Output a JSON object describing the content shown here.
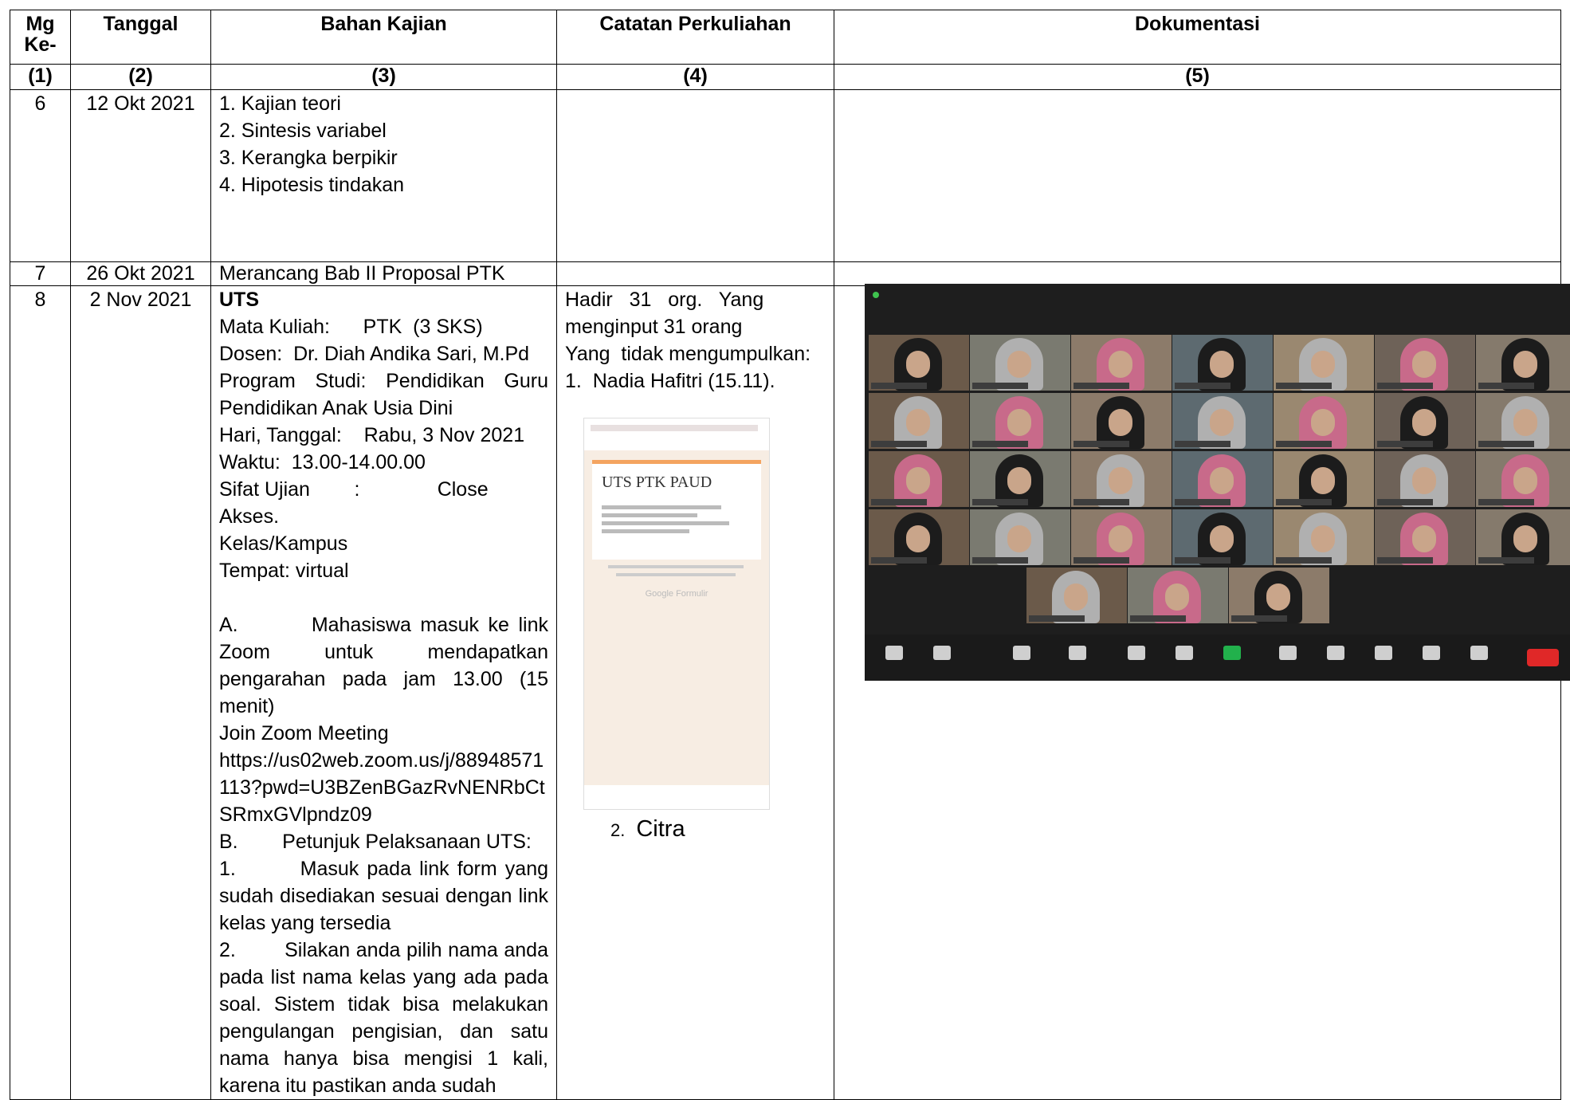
{
  "header": {
    "col1": "Mg Ke-",
    "col2": "Tanggal",
    "col3": "Bahan Kajian",
    "col4": "Catatan Perkuliahan",
    "col5": "Dokumentasi"
  },
  "numbers": [
    "(1)",
    "(2)",
    "(3)",
    "(4)",
    "(5)"
  ],
  "rows": [
    {
      "mg": "6",
      "tanggal": "12 Okt 2021",
      "bahan": [
        "1. Kajian teori",
        "2. Sintesis variabel",
        "3. Kerangka berpikir",
        "4. Hipotesis tindakan"
      ]
    },
    {
      "mg": "7",
      "tanggal": "26 Okt 2021",
      "bahan": "Merancang Bab II Proposal PTK"
    },
    {
      "mg": "8",
      "tanggal": "2 Nov 2021",
      "bahan": {
        "title": "UTS",
        "matkul": "Mata Kuliah:      PTK  (3 SKS)",
        "dosen": "Dosen:  Dr. Diah Andika Sari, M.Pd",
        "prodi": "Program Studi:  Pendidikan  Guru",
        "prodi2": "Pendidikan Anak Usia Dini",
        "hari": "Hari, Tanggal:    Rabu, 3 Nov 2021",
        "waktu": "Waktu:  13.00-14.00.00",
        "sifat": "Sifat Ujian        :              Close",
        "sifat2": "Akses.",
        "kelas": "Kelas/Kampus",
        "tempat": "Tempat: virtual",
        "a": "A.        Mahasiswa masuk ke link Zoom untuk mendapatkan pengarahan pada jam 13.00 (15 menit)",
        "join": "Join Zoom Meeting",
        "link1": "https://us02web.zoom.us/j/88948571",
        "link2": "113?pwd=U3BZenBGazRvNENRbCt",
        "link3": "SRmxGVlpndz09",
        "b": "B.        Petunjuk Pelaksanaan UTS:",
        "b1": "1.        Masuk pada link form yang sudah disediakan sesuai dengan link kelas yang tersedia",
        "b2": "2.        Silakan anda pilih nama anda pada list nama kelas yang ada pada soal. Sistem tidak bisa melakukan pengulangan pengisian, dan satu nama hanya bisa mengisi 1 kali, karena itu pastikan anda sudah"
      },
      "catatan": {
        "line1": "Hadir   31   org.   Yang",
        "line2": "menginput 31 orang",
        "line3": "Yang  tidak mengumpulkan:",
        "line4": "1.  Nadia Hafitri (15.11).",
        "item2_num": "2.",
        "item2_name": "Citra"
      }
    }
  ],
  "form_screenshot": {
    "title": "UTS PTK PAUD",
    "footer": "Google Formulir"
  }
}
